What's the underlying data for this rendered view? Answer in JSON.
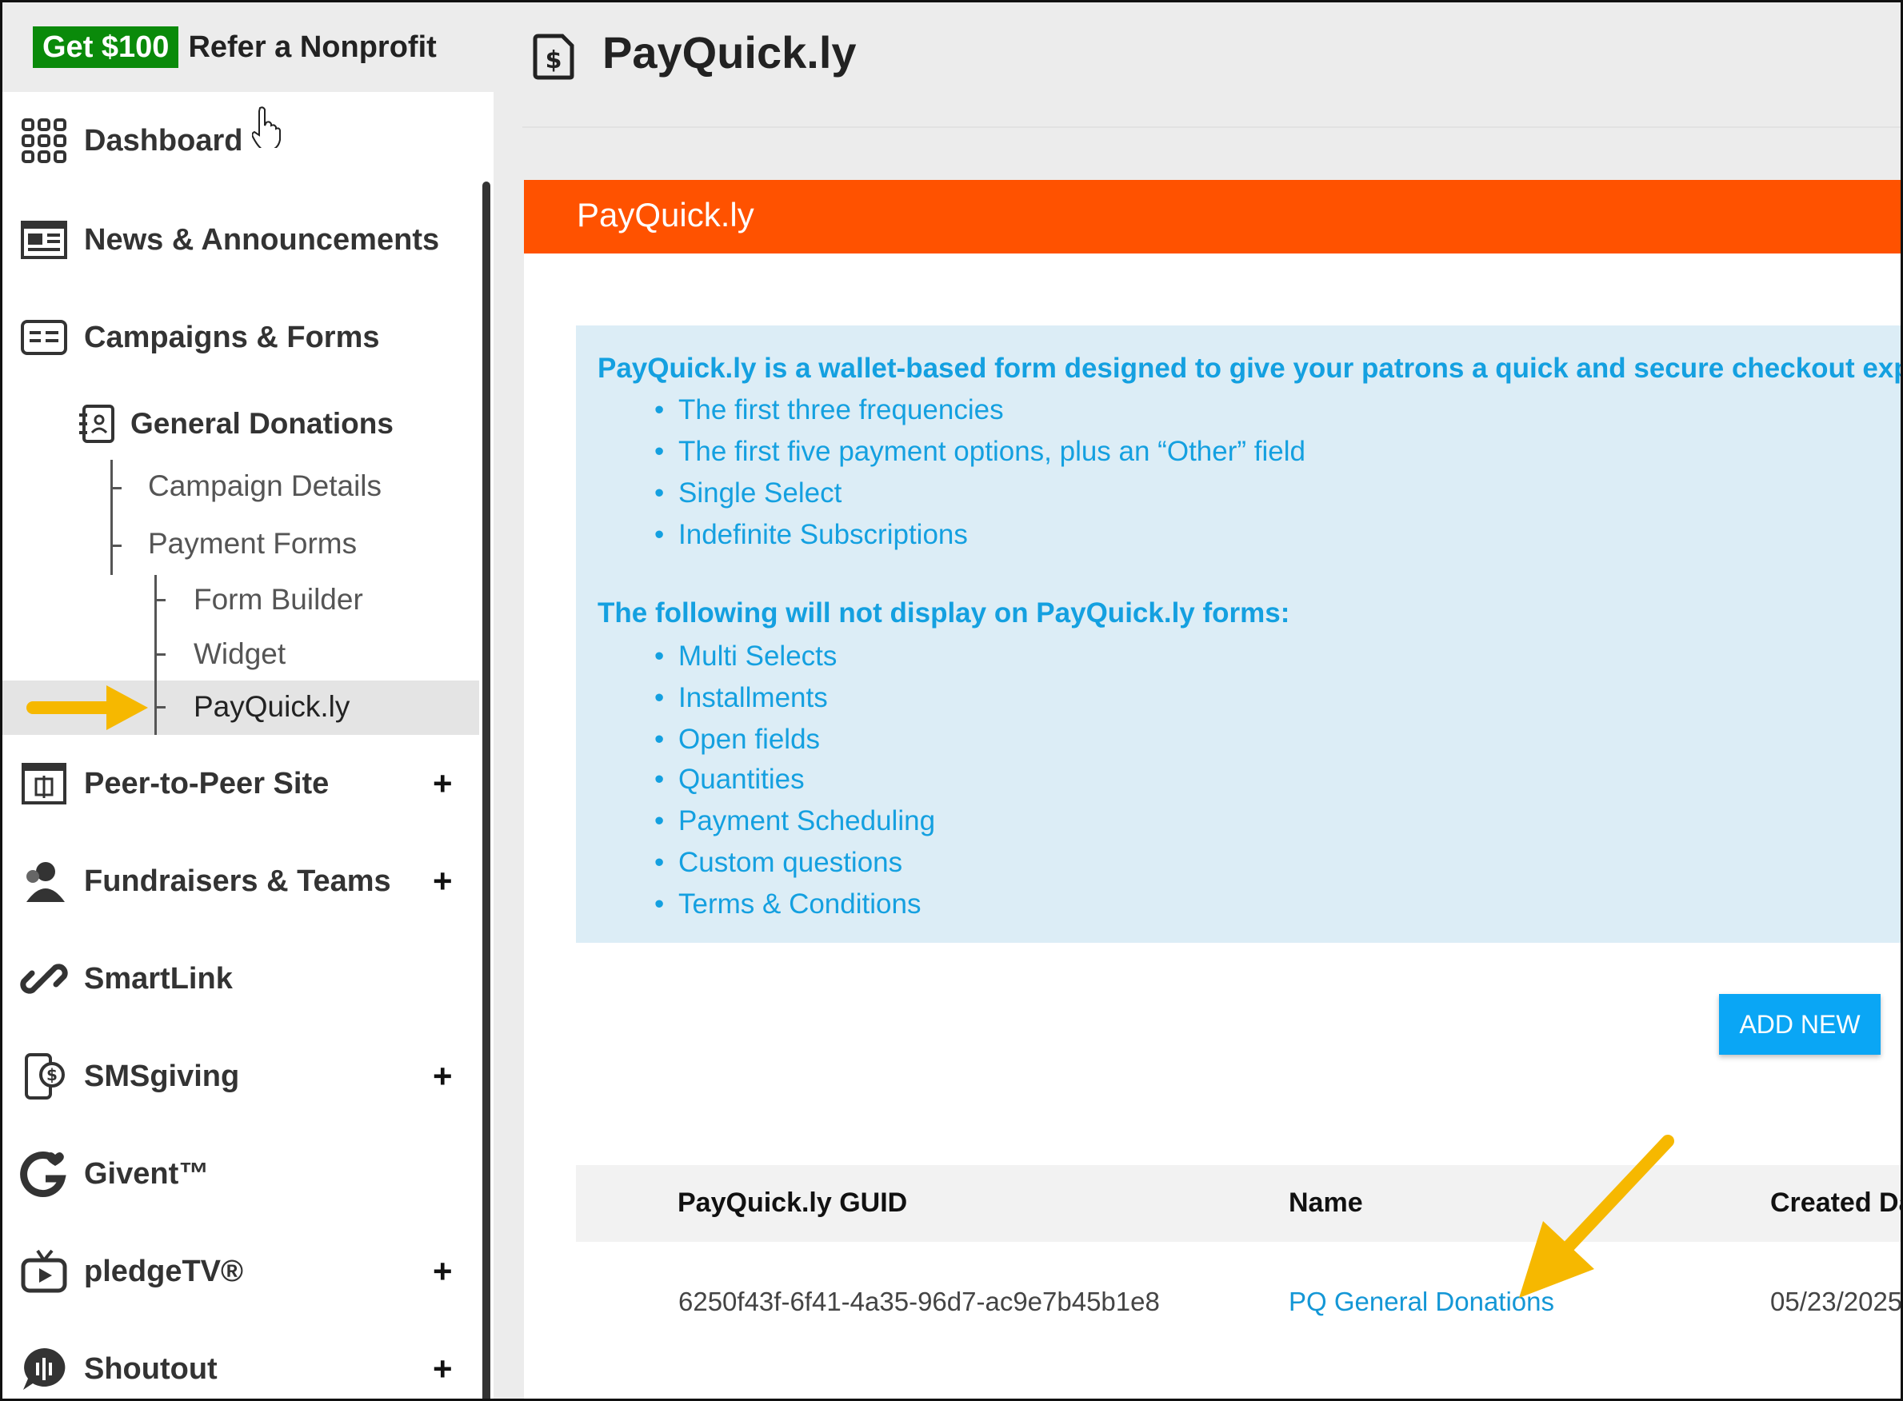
{
  "promo": {
    "badge": "Get $100",
    "text": "Refer a Nonprofit"
  },
  "sidebar": {
    "items": [
      {
        "label": "Dashboard",
        "icon": "grid-icon",
        "expandable": false
      },
      {
        "label": "News & Announcements",
        "icon": "newspaper-icon",
        "expandable": false
      },
      {
        "label": "Campaigns & Forms",
        "icon": "id-card-icon",
        "expandable": false
      },
      {
        "label": "Peer-to-Peer Site",
        "icon": "frame-icon",
        "expandable": true,
        "expander": "+"
      },
      {
        "label": "Fundraisers & Teams",
        "icon": "people-icon",
        "expandable": true,
        "expander": "+"
      },
      {
        "label": "SmartLink",
        "icon": "link-icon",
        "expandable": false
      },
      {
        "label": "SMSgiving",
        "icon": "phone-dollar-icon",
        "expandable": true,
        "expander": "+"
      },
      {
        "label": "Givent™",
        "icon": "givent-icon",
        "expandable": false
      },
      {
        "label": "pledgeTV®",
        "icon": "tv-icon",
        "expandable": true,
        "expander": "+"
      },
      {
        "label": "Shoutout",
        "icon": "chat-icon",
        "expandable": true,
        "expander": "+"
      }
    ],
    "campaign": {
      "label": "General Donations",
      "children": [
        {
          "label": "Campaign Details"
        },
        {
          "label": "Payment Forms"
        }
      ],
      "payment_form_children": [
        {
          "label": "Form Builder"
        },
        {
          "label": "Widget"
        },
        {
          "label": "PayQuick.ly",
          "active": true
        }
      ]
    }
  },
  "main": {
    "title": "PayQuick.ly",
    "panel_title": "PayQuick.ly",
    "info": {
      "heading1": "PayQuick.ly is a wallet-based form designed to give your patrons a quick and secure checkout experience",
      "list1": [
        "The first three frequencies",
        "The first five payment options, plus an “Other” field",
        "Single Select",
        "Indefinite Subscriptions"
      ],
      "heading2": "The following will not display on PayQuick.ly forms:",
      "list2": [
        "Multi Selects",
        "Installments",
        "Open fields",
        "Quantities",
        "Payment Scheduling",
        "Custom questions",
        "Terms & Conditions"
      ]
    },
    "add_button": "ADD NEW",
    "table": {
      "columns": [
        "PayQuick.ly GUID",
        "Name",
        "Created Date"
      ],
      "rows": [
        {
          "guid": "6250f43f-6f41-4a35-96d7-ac9e7b45b1e8",
          "name": "PQ General Donations",
          "created": "05/23/2025"
        }
      ]
    }
  },
  "colors": {
    "accent_orange": "#ff5200",
    "link_blue": "#14a0e0",
    "button_blue": "#0aa6f5",
    "promo_green": "#0a8a0a",
    "annotation_yellow": "#f6b800"
  }
}
